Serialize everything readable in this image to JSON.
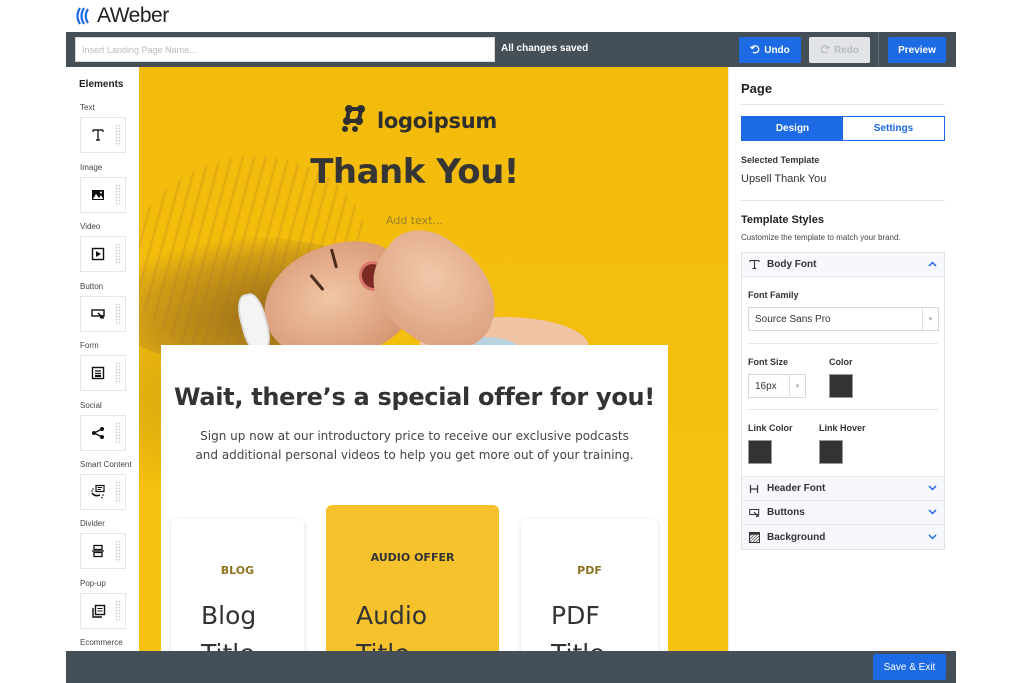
{
  "brand": {
    "name": "AWeber",
    "logo_icon": "aweber-waves-icon"
  },
  "topbar": {
    "name_input": {
      "placeholder": "Insert Landing Page Name...",
      "value": ""
    },
    "save_status": "All changes saved",
    "undo_label": "Undo",
    "undo_icon": "undo-icon",
    "redo_label": "Redo",
    "redo_icon": "redo-icon",
    "redo_enabled": false,
    "preview_label": "Preview"
  },
  "sidebar": {
    "title": "Elements",
    "items": [
      {
        "label": "Text",
        "icon": "text-icon"
      },
      {
        "label": "Image",
        "icon": "image-icon"
      },
      {
        "label": "Video",
        "icon": "video-icon"
      },
      {
        "label": "Button",
        "icon": "button-icon"
      },
      {
        "label": "Form",
        "icon": "form-icon"
      },
      {
        "label": "Social",
        "icon": "share-icon"
      },
      {
        "label": "Smart Content",
        "icon": "smart-content-icon"
      },
      {
        "label": "Divider",
        "icon": "divider-icon"
      },
      {
        "label": "Pop-up",
        "icon": "popup-icon"
      },
      {
        "label": "Ecommerce",
        "icon": "ecommerce-icon"
      }
    ]
  },
  "canvas": {
    "logo_text": "logoipsum",
    "title": "Thank You!",
    "add_text_placeholder": "Add text...",
    "offer_title": "Wait, there’s a special offer for you!",
    "offer_description": "Sign up now at our introductory price to receive our exclusive podcasts and additional personal videos to help you get more out of your training.",
    "cards": [
      {
        "label": "BLOG",
        "title": "Blog Title"
      },
      {
        "label": "AUDIO OFFER",
        "title": "Audio Title"
      },
      {
        "label": "PDF",
        "title": "PDF Title"
      }
    ],
    "background_color": "#f4bd0c"
  },
  "right_panel": {
    "title": "Page",
    "tabs": [
      {
        "label": "Design",
        "active": true
      },
      {
        "label": "Settings",
        "active": false
      }
    ],
    "selected_template_label": "Selected Template",
    "selected_template_value": "Upsell Thank You",
    "template_styles_title": "Template Styles",
    "template_styles_subtitle": "Customize the template to match your brand.",
    "body_font": {
      "label": "Body Font",
      "icon": "text-icon",
      "expanded": true,
      "font_family_label": "Font Family",
      "font_family_value": "Source Sans Pro",
      "font_size_label": "Font Size",
      "font_size_value": "16px",
      "color_label": "Color",
      "color_value": "#333333",
      "link_color_label": "Link Color",
      "link_color_value": "#333333",
      "link_hover_label": "Link Hover",
      "link_hover_value": "#333333"
    },
    "sections": [
      {
        "label": "Header Font",
        "icon": "heading-icon"
      },
      {
        "label": "Buttons",
        "icon": "button-icon"
      },
      {
        "label": "Background",
        "icon": "background-icon"
      }
    ]
  },
  "bottombar": {
    "save_exit_label": "Save & Exit"
  },
  "colors": {
    "accent": "#1d6ae5",
    "toolbar": "#444f58",
    "redo_disabled": "#e2e4e7"
  }
}
